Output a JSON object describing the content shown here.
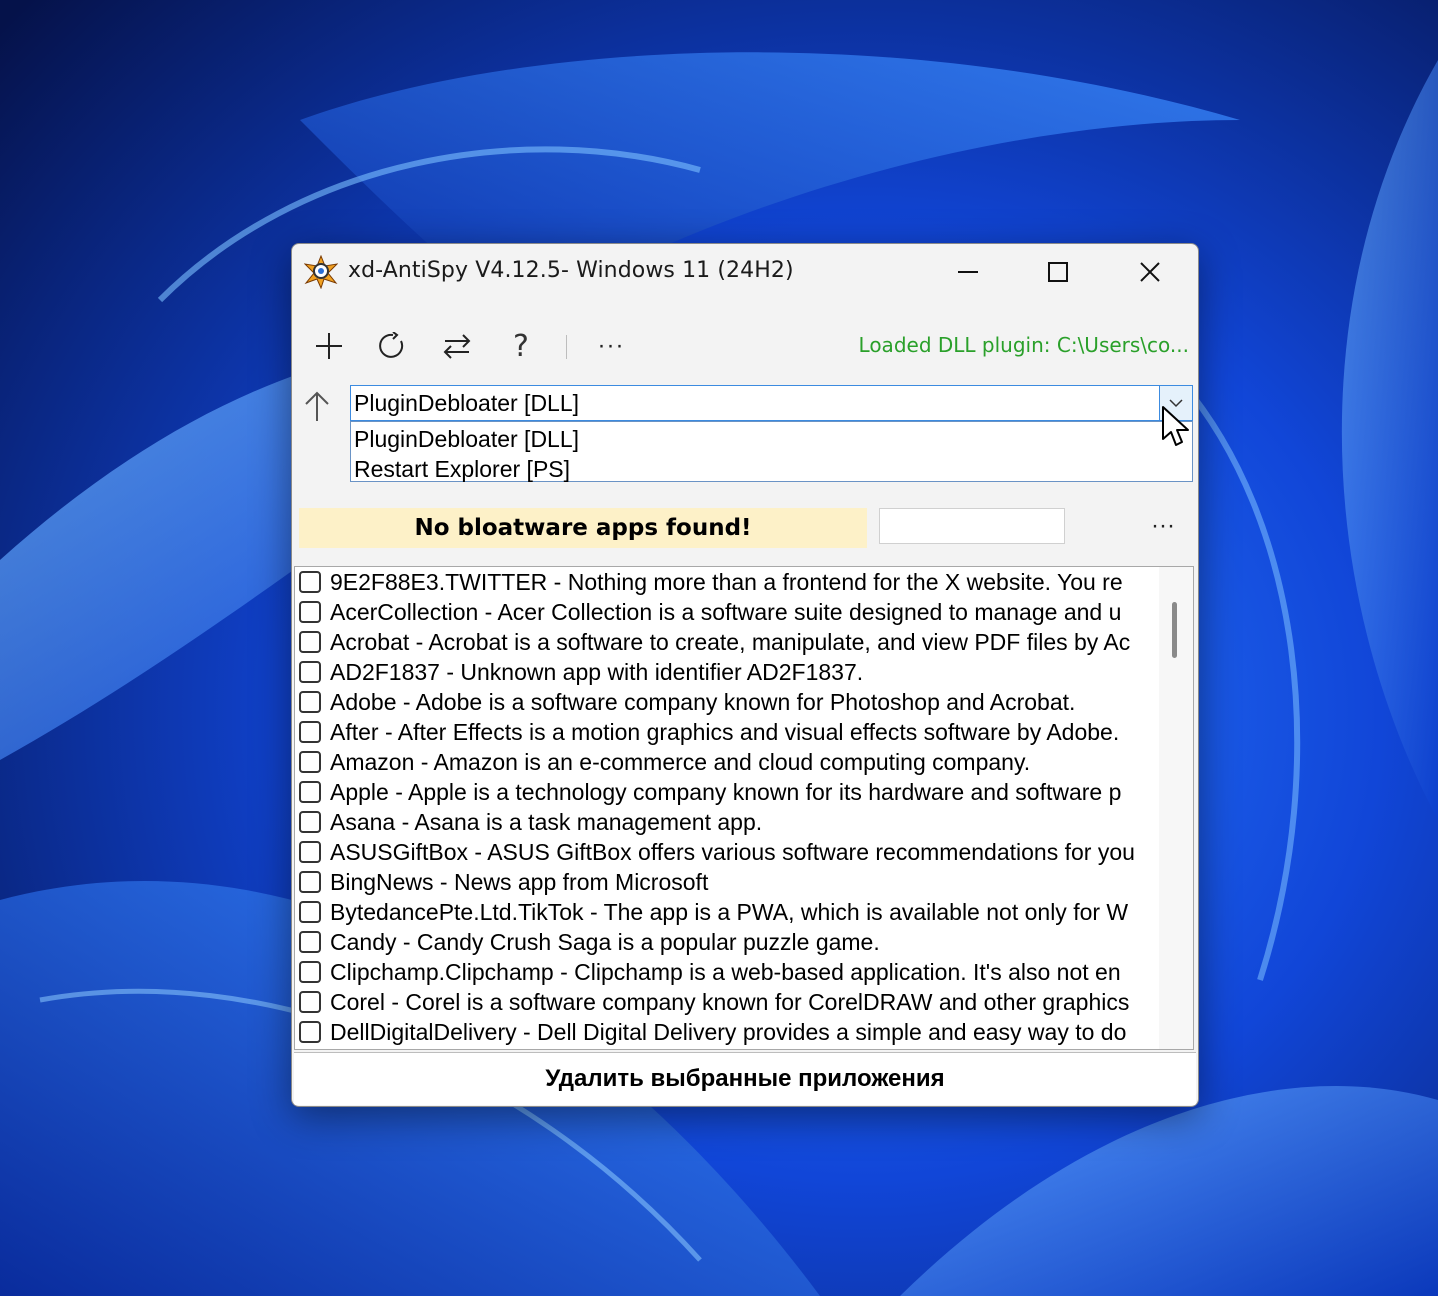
{
  "window": {
    "title": "xd-AntiSpy V4.12.5- Windows 11 (24H2)"
  },
  "toolbar": {
    "add_icon": "plus-icon",
    "refresh_icon": "refresh-icon",
    "swap_icon": "swap-arrows-icon",
    "help_label": "?",
    "more_label": "···",
    "status": "Loaded DLL plugin: C:\\Users\\co..."
  },
  "plugin_select": {
    "value": "PluginDebloater [DLL]",
    "options": [
      "PluginDebloater [DLL]",
      "Restart Explorer [PS]"
    ]
  },
  "banner": {
    "text": "No bloatware apps found!",
    "color": "#fdf1c8"
  },
  "search": {
    "value": ""
  },
  "list_more_label": "···",
  "apps": [
    {
      "text": "9E2F88E3.TWITTER - Nothing more than a frontend for the X website. You re",
      "checked": false
    },
    {
      "text": "AcerCollection - Acer Collection is a software suite designed to manage and u",
      "checked": false
    },
    {
      "text": "Acrobat - Acrobat is a software to create, manipulate, and view PDF files by Ac",
      "checked": false
    },
    {
      "text": "AD2F1837 - Unknown app with identifier AD2F1837.",
      "checked": false
    },
    {
      "text": "Adobe - Adobe is a software company known for Photoshop and Acrobat.",
      "checked": false
    },
    {
      "text": "After - After Effects is a motion graphics and visual effects software by Adobe.",
      "checked": false
    },
    {
      "text": "Amazon - Amazon is an e-commerce and cloud computing company.",
      "checked": false
    },
    {
      "text": "Apple - Apple is a technology company known for its hardware and software p",
      "checked": false
    },
    {
      "text": "Asana - Asana is a task management app.",
      "checked": false
    },
    {
      "text": "ASUSGiftBox - ASUS GiftBox offers various software recommendations for you",
      "checked": false
    },
    {
      "text": "BingNews - News app from Microsoft",
      "checked": false
    },
    {
      "text": "BytedancePte.Ltd.TikTok - The app is a PWA, which is available not only for W",
      "checked": false
    },
    {
      "text": "Candy - Candy Crush Saga is a popular puzzle game.",
      "checked": false
    },
    {
      "text": "Clipchamp.Clipchamp - Clipchamp is a web-based application. It's also not en",
      "checked": false
    },
    {
      "text": "Corel - Corel is a software company known for CorelDRAW and other graphics",
      "checked": false
    },
    {
      "text": "DellDigitalDelivery - Dell Digital Delivery provides a simple and easy way to do",
      "checked": false
    }
  ],
  "action_button": "Удалить выбранные приложения",
  "colors": {
    "status_green": "#2aa02a",
    "accent_blue": "#3c8be0"
  }
}
